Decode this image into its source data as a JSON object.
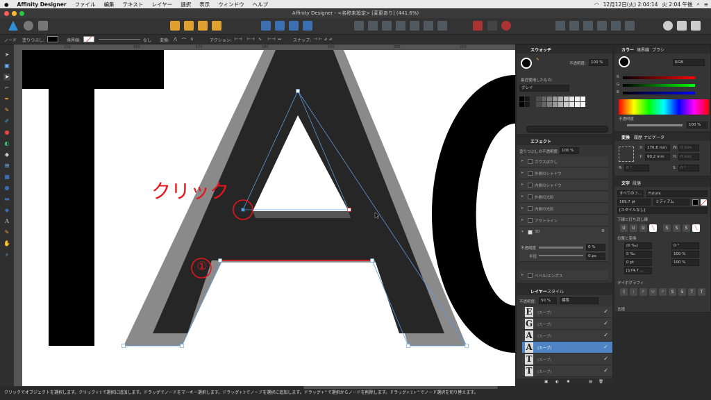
{
  "menubar": {
    "apple": "",
    "app": "Affinity Designer",
    "items": [
      "ファイル",
      "編集",
      "テキスト",
      "レイヤー",
      "選択",
      "表示",
      "ウィンドウ",
      "ヘルプ"
    ],
    "date_time": "12月12日(火) 2:04:14",
    "battery_time": "火 2:04 午後"
  },
  "title": "Affinity Designer - <名称未設定> [変更あり] (441.6%)",
  "context_bar": {
    "mode": "ノード",
    "fill_label": "塗りつぶし:",
    "stroke_label": "境界線:",
    "none_label": "なし",
    "transform_label": "変換:",
    "action_label": "アクション:",
    "snap_label": "スナップ:"
  },
  "ruler_ticks": [
    "150",
    "160",
    "170",
    "180",
    "190",
    "200",
    "210"
  ],
  "canvas": {
    "annotation_click": "クリック",
    "annotation_one": "①"
  },
  "status": "クリックでオブジェクトを選択します。クリック+⇧で選択に追加します。ドラッグでノードをマーキー選択します。ドラッグ+⇧でノードを選択に追加します。ドラッグ+⌃で選択からノードを削除します。ドラッグ+⇧+⌃でノード選択を切り替えます。",
  "swatches": {
    "tab": "スウォッチ",
    "opacity_label": "不透明度:",
    "opacity": "100 %",
    "recent_label": "最近使用したもの:",
    "palette": "グレイ",
    "colors": [
      "#000000",
      "#1a1a1a",
      "#333333",
      "#4d4d4d",
      "#666666",
      "#808080",
      "#999999",
      "#b3b3b3",
      "#cccccc",
      "#e6e6e6",
      "#f2f2f2",
      "#ffffff"
    ]
  },
  "color": {
    "tabs": [
      "カラー",
      "境界線",
      "ブラシ"
    ],
    "mode": "RGB",
    "channels": [
      "R",
      "G",
      "B"
    ],
    "opacity_label": "不透明度",
    "opacity": "100 %"
  },
  "effects": {
    "tab": "エフェクト",
    "fill_opacity_label": "塗りつぶしの不透明度:",
    "fill_opacity": "100 %",
    "items": [
      "ガウスぼかし",
      "外側のシャドウ",
      "内側のシャドウ",
      "外側の光彩",
      "内側の光彩",
      "アウトライン"
    ],
    "threed": "3D",
    "threed_opacity_label": "不透明度",
    "threed_opacity": "0 %",
    "radius_label": "半径",
    "radius": "0 px",
    "bevel": "ベベル/エンボス"
  },
  "transform": {
    "tabs": [
      "変換",
      "履歴",
      "ナビゲータ"
    ],
    "x_label": "X:",
    "x": "176.8 mm",
    "y_label": "Y:",
    "y": "90.2 mm",
    "w_label": "W:",
    "w": "0 mm",
    "h_label": "H:",
    "h": "0 mm",
    "r_label": "R:",
    "r": "0 °",
    "s_label": "S:",
    "s": "0 °"
  },
  "text": {
    "tabs": [
      "文字",
      "段落"
    ],
    "font_collection": "すべてのフ...",
    "font": "Futura",
    "size": "169.7 pt",
    "weight": "ミディアム",
    "style": "[スタイルなし]",
    "underline_section": "下線と打ち消し線",
    "position_section": "位置と変換",
    "kerning": "(0 ‰)",
    "tracking": "0 ‰",
    "baseline": "0 pt",
    "leading": "[174.7 ...",
    "angle": "0 °",
    "hscale": "100 %",
    "vscale": "100 %",
    "typography_section": "タイポグラフィ",
    "lang_section": "言語"
  },
  "layers": {
    "tabs": [
      "レイヤー",
      "スタイル"
    ],
    "opacity_label": "不透明度:",
    "opacity": "50 %",
    "blend": "標準",
    "items": [
      {
        "letter": "E",
        "name": "(カーブ)"
      },
      {
        "letter": "G",
        "name": "(カーブ)"
      },
      {
        "letter": "A",
        "name": "(カーブ)"
      },
      {
        "letter": "A",
        "name": "(カーブ)"
      },
      {
        "letter": "T",
        "name": "(カーブ)"
      },
      {
        "letter": "T",
        "name": "(カーブ)"
      }
    ],
    "selected_index": 3
  },
  "accent": "#4e84c4",
  "annotation_color": "#e8141c"
}
